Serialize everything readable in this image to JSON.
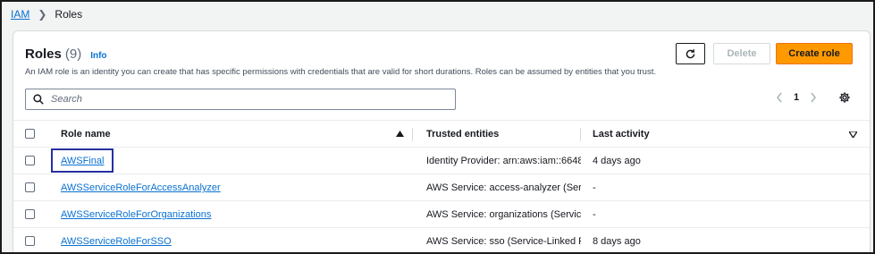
{
  "breadcrumb": {
    "parent": "IAM",
    "current": "Roles"
  },
  "header": {
    "title": "Roles",
    "count": "(9)",
    "info": "Info",
    "description": "An IAM role is an identity you can create that has specific permissions with credentials that are valid for short durations. Roles can be assumed by entities that you trust.",
    "delete_label": "Delete",
    "create_label": "Create role"
  },
  "search": {
    "placeholder": "Search",
    "value": ""
  },
  "pagination": {
    "page": "1"
  },
  "table": {
    "columns": {
      "name": "Role name",
      "trusted": "Trusted entities",
      "last": "Last activity"
    },
    "rows": [
      {
        "name": "AWSFinal",
        "trusted_prefix": "Identity Provider: arn:aws:iam::6648",
        "trusted_link": "",
        "last": "4 days ago"
      },
      {
        "name": "AWSServiceRoleForAccessAnalyzer",
        "trusted_prefix": "AWS Service: access-analyzer (",
        "trusted_link": "Servic",
        "last": "-"
      },
      {
        "name": "AWSServiceRoleForOrganizations",
        "trusted_prefix": "AWS Service: organizations (",
        "trusted_link": "Service-",
        "last": "-"
      },
      {
        "name": "AWSServiceRoleForSSO",
        "trusted_prefix": "AWS Service: sso (",
        "trusted_link": "Service-Linked Rol",
        "last": "8 days ago"
      }
    ]
  },
  "colors": {
    "link": "#0972d3",
    "primary": "#ff9900",
    "highlight_box": "#2631a0"
  },
  "icons": {
    "refresh": "refresh-icon",
    "search": "search-icon",
    "settings": "gear-icon",
    "sort": "sort-ascending-icon",
    "filter": "caret-down-icon"
  }
}
